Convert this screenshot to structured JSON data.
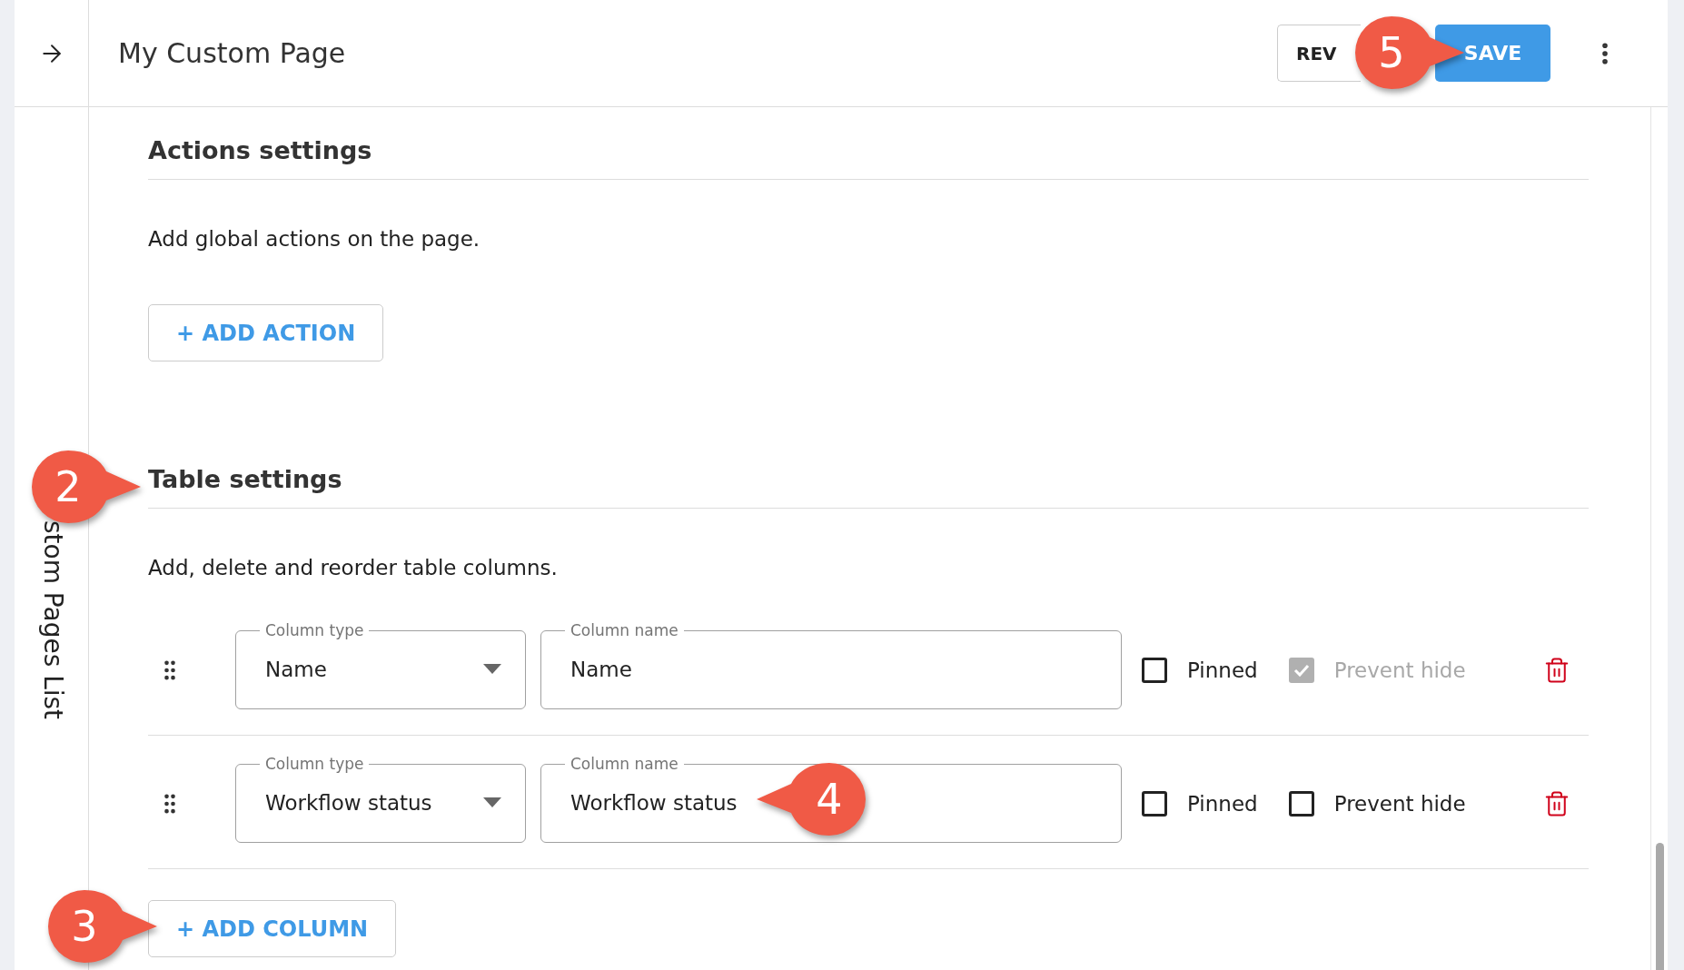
{
  "header": {
    "title": "My Custom Page",
    "buttons": [
      {
        "label": "REV",
        "kind": "outlined"
      },
      {
        "label": "SAVE",
        "kind": "primary"
      }
    ]
  },
  "sidebar": {
    "label": "stom Pages List"
  },
  "sections": [
    {
      "title": "Actions settings",
      "description": "Add global actions on the page.",
      "add_button": "+ ADD ACTION"
    },
    {
      "title": "Table settings",
      "description": "Add, delete and reorder table columns.",
      "columns": [
        {
          "type_label": "Column type",
          "type": "Name",
          "name_label": "Column name",
          "name": "Name",
          "pinned_label": "Pinned",
          "pinned": false,
          "prevent_hide_label": "Prevent hide",
          "prevent_hide": true,
          "prevent_hide_disabled": true
        },
        {
          "type_label": "Column type",
          "type": "Workflow status",
          "name_label": "Column name",
          "name": "Workflow status",
          "pinned_label": "Pinned",
          "pinned": false,
          "prevent_hide_label": "Prevent hide",
          "prevent_hide": false,
          "prevent_hide_disabled": false
        }
      ],
      "add_button": "+ ADD COLUMN"
    }
  ],
  "callouts": [
    {
      "number": "5"
    },
    {
      "number": "2"
    },
    {
      "number": "4"
    },
    {
      "number": "3"
    }
  ]
}
